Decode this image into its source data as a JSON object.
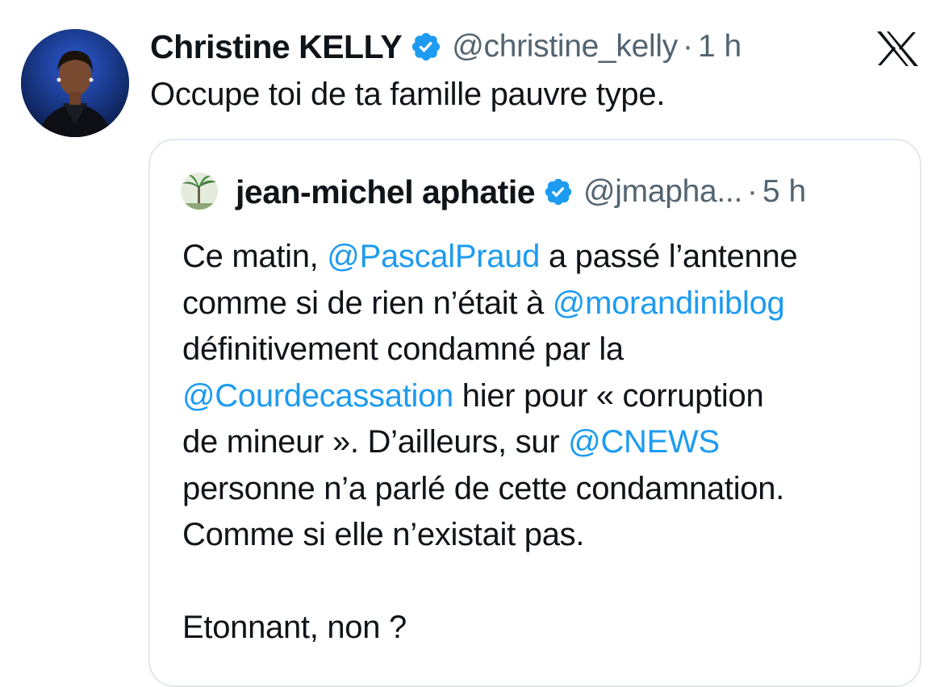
{
  "tweet": {
    "author_name": "Christine KELLY",
    "handle": "@christine_kelly",
    "separator": "·",
    "time": "1 h",
    "text": "Occupe toi de ta famille pauvre type.",
    "verified_icon": "verified-badge-icon",
    "brand_icon": "x-logo-icon"
  },
  "quote": {
    "author_name": "jean-michel aphatie",
    "handle": "@jmapha...",
    "separator": "·",
    "time": "5 h",
    "lines": [
      {
        "a": "Ce matin, ",
        "m": "@PascalPraud",
        "b": " a passé l’antenne"
      },
      {
        "a": "comme si de rien n’était à ",
        "m": "@morandiniblog",
        "b": ""
      },
      {
        "a": "définitivement condamné par la",
        "m": "",
        "b": ""
      },
      {
        "a": "",
        "m": "@Courdecassation",
        "b": " hier pour « corruption"
      },
      {
        "a": "de mineur ». D’ailleurs, sur ",
        "m": "@CNEWS",
        "b": ""
      },
      {
        "a": "personne n’a parlé de cette condamnation.",
        "m": "",
        "b": ""
      },
      {
        "a": "Comme si elle n’existait pas.",
        "m": "",
        "b": ""
      },
      {
        "a": "",
        "m": "",
        "b": ""
      },
      {
        "a": "Etonnant, non ?",
        "m": "",
        "b": ""
      }
    ]
  },
  "colors": {
    "text": "#0f1419",
    "secondary": "#536471",
    "link": "#1d9bf0",
    "verified": "#1d9bf0",
    "border": "#e3e7ea"
  }
}
